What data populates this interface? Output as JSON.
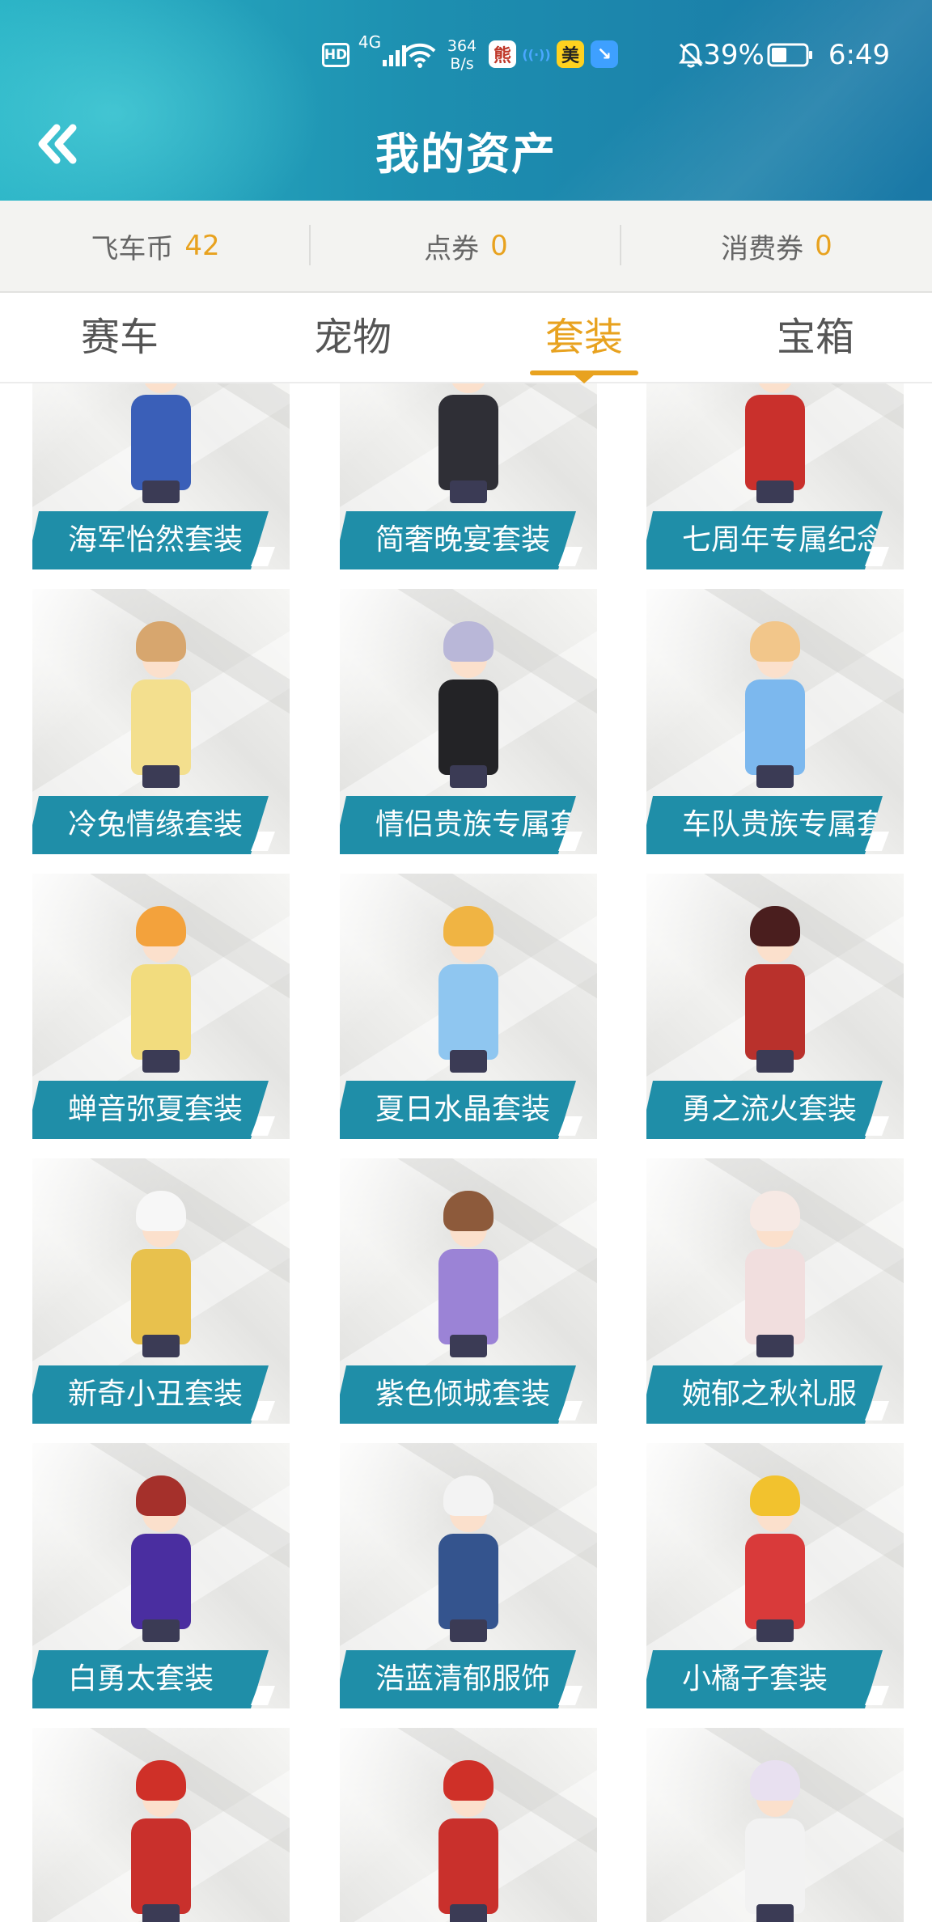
{
  "status_bar": {
    "hd": "HD",
    "signal": "4G",
    "speed_top": "364",
    "speed_bottom": "B/s",
    "battery": "39%",
    "time": "6:49",
    "apps": [
      {
        "icon": "app-icon-bear",
        "glyph": "熊",
        "color": "#ffffff"
      },
      {
        "icon": "app-icon-signal",
        "glyph": "((·))",
        "color": "#4aa7ff"
      },
      {
        "icon": "app-icon-meituan",
        "glyph": "美",
        "color": "#ffd21f"
      },
      {
        "icon": "app-icon-blue",
        "glyph": "↘",
        "color": "#3ea0ff"
      }
    ]
  },
  "header": {
    "back_icon": "double-chevron-left-icon",
    "title": "我的资产"
  },
  "balances": [
    {
      "label": "飞车币",
      "value": "42"
    },
    {
      "label": "点券",
      "value": "0"
    },
    {
      "label": "消费券",
      "value": "0"
    }
  ],
  "tabs": [
    {
      "label": "赛车",
      "active": false
    },
    {
      "label": "宠物",
      "active": false
    },
    {
      "label": "套装",
      "active": true
    },
    {
      "label": "宝箱",
      "active": false
    }
  ],
  "colors": {
    "accent": "#e8a21f",
    "header_start": "#2ab3c6",
    "header_end": "#1a78a6",
    "label_bg": "#1f8ea8"
  },
  "items": [
    {
      "name": "海军怡然套装",
      "hair": "#f2c77a",
      "body": "#3a5fb8"
    },
    {
      "name": "简奢晚宴套装",
      "hair": "#c99a52",
      "body": "#2f2f36"
    },
    {
      "name": "七周年专属纪念",
      "hair": "#8a3a2a",
      "body": "#c9302c"
    },
    {
      "name": "冷兔情缘套装",
      "hair": "#d7a66e",
      "body": "#f3df8e"
    },
    {
      "name": "情侣贵族专属套装",
      "hair": "#b9b7d8",
      "body": "#232326"
    },
    {
      "name": "车队贵族专属套装",
      "hair": "#f2c68a",
      "body": "#7cb8ee"
    },
    {
      "name": "蝉音弥夏套装",
      "hair": "#f3a23c",
      "body": "#f2dc7e"
    },
    {
      "name": "夏日水晶套装",
      "hair": "#f0b443",
      "body": "#8fc6f0"
    },
    {
      "name": "勇之流火套装",
      "hair": "#4a1e1e",
      "body": "#b9312c"
    },
    {
      "name": "新奇小丑套装",
      "hair": "#f7f7f7",
      "body": "#e8c14d"
    },
    {
      "name": "紫色倾城套装",
      "hair": "#8d5a3b",
      "body": "#9b83d6"
    },
    {
      "name": "婉郁之秋礼服",
      "hair": "#f6e9e4",
      "body": "#f1dede"
    },
    {
      "name": "白勇太套装",
      "hair": "#a5302b",
      "body": "#4a2ea0"
    },
    {
      "name": "浩蓝清郁服饰",
      "hair": "#f3f3f3",
      "body": "#34548e"
    },
    {
      "name": "小橘子套装",
      "hair": "#f2c22e",
      "body": "#d93a3a"
    },
    {
      "name": "",
      "hair": "#cf3028",
      "body": "#c9302c"
    },
    {
      "name": "",
      "hair": "#cf3028",
      "body": "#c9302c"
    },
    {
      "name": "",
      "hair": "#e8e0f0",
      "body": "#f2f2f2"
    }
  ]
}
